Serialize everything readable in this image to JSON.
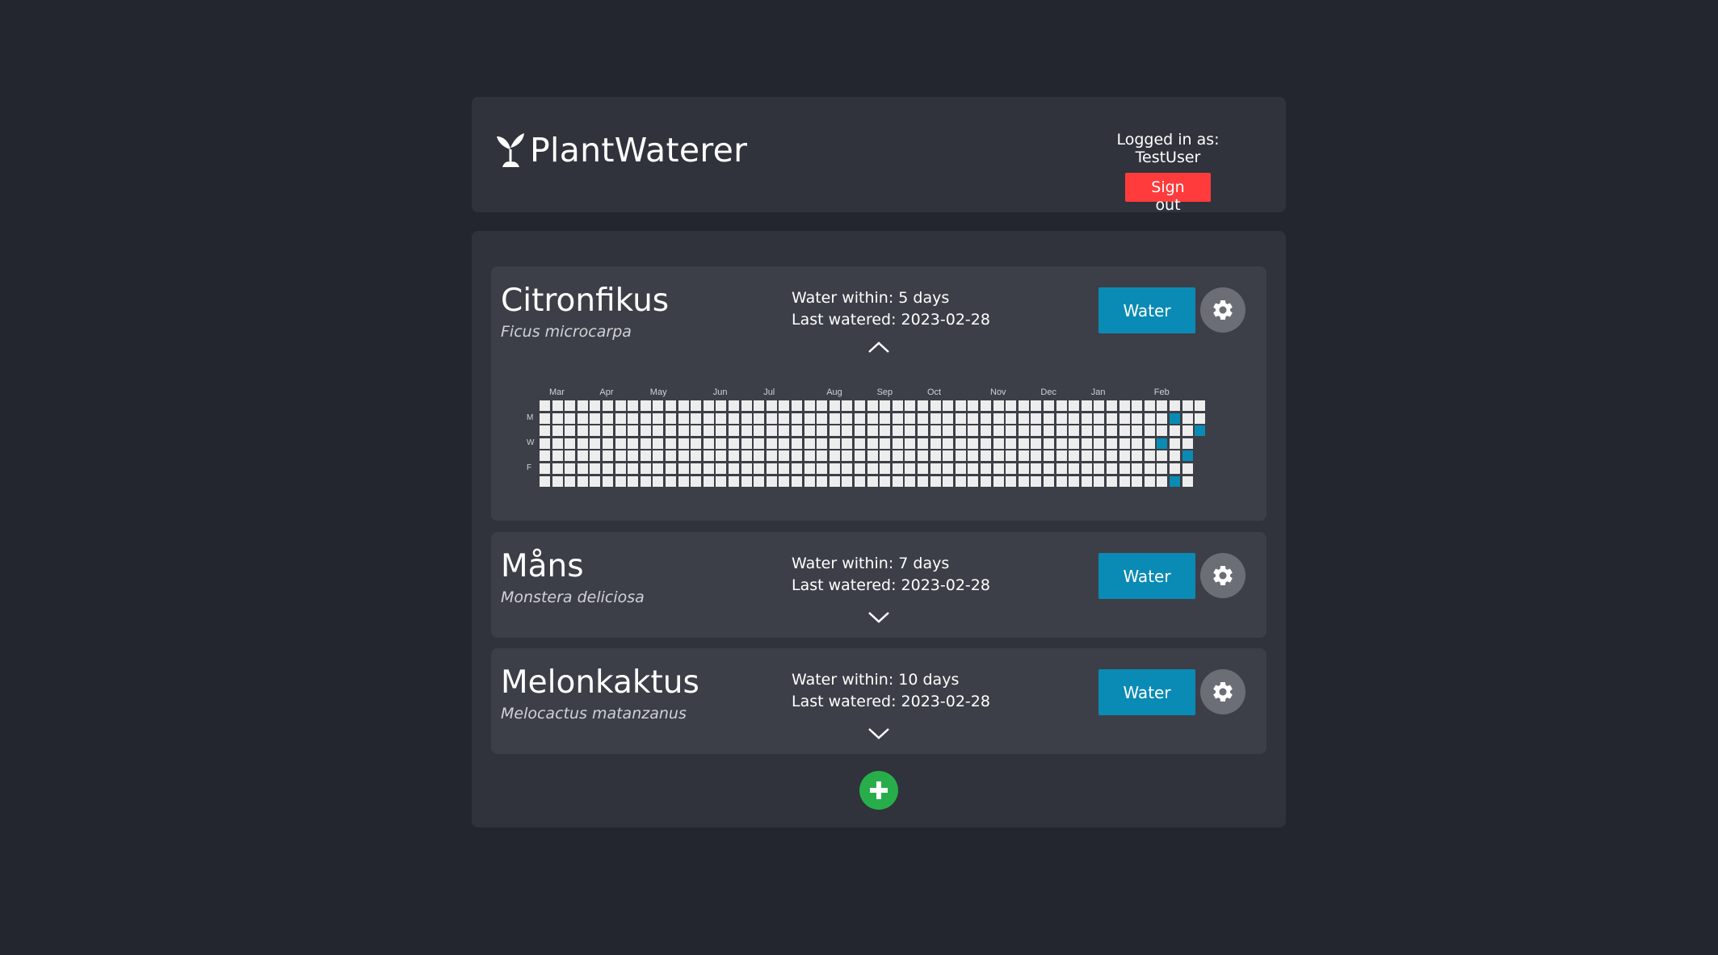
{
  "header": {
    "app_name": "PlantWaterer",
    "logo_icon": "plant-sprout-icon",
    "logged_in_text": "Logged in as: TestUser",
    "sign_out_label": "Sign out"
  },
  "plants": [
    {
      "name": "Citronfikus",
      "scientific_name": "Ficus microcarpa",
      "water_within": "Water within: 5 days",
      "last_watered": "Last watered: 2023-02-28",
      "water_label": "Water",
      "expanded": true,
      "toggle_icon": "chevron-up-icon"
    },
    {
      "name": "Måns",
      "scientific_name": "Monstera deliciosa",
      "water_within": "Water within: 7 days",
      "last_watered": "Last watered: 2023-02-28",
      "water_label": "Water",
      "expanded": false,
      "toggle_icon": "chevron-down-icon"
    },
    {
      "name": "Melonkaktus",
      "scientific_name": "Melocactus matanzanus",
      "water_within": "Water within: 10 days",
      "last_watered": "Last watered: 2023-02-28",
      "water_label": "Water",
      "expanded": false,
      "toggle_icon": "chevron-down-icon"
    }
  ],
  "heatmap": {
    "months": [
      "Mar",
      "Apr",
      "May",
      "Jun",
      "Jul",
      "Aug",
      "Sep",
      "Oct",
      "Nov",
      "Dec",
      "Jan",
      "Feb"
    ],
    "month_start_weeks": [
      0,
      4,
      8,
      13,
      17,
      22,
      26,
      30,
      35,
      39,
      43,
      48
    ],
    "day_labels": [
      "M",
      "W",
      "F"
    ],
    "weeks": 53,
    "watered_cells": [
      {
        "week": 50,
        "day": 1
      },
      {
        "week": 52,
        "day": 2
      },
      {
        "week": 49,
        "day": 3
      },
      {
        "week": 51,
        "day": 4
      },
      {
        "week": 50,
        "day": 6
      }
    ],
    "last_week_days": 3,
    "cell_color": "#ededed",
    "watered_color": "#0a8bb5"
  },
  "add_button": {
    "icon": "plus-icon"
  },
  "colors": {
    "background": "#23262e",
    "card": "#30333b",
    "plant_card": "#3c3f47",
    "water_button": "#0a8bb5",
    "sign_out_button": "#ff3b3b",
    "add_button": "#27ae4a",
    "gear_button": "#6b6e75"
  }
}
